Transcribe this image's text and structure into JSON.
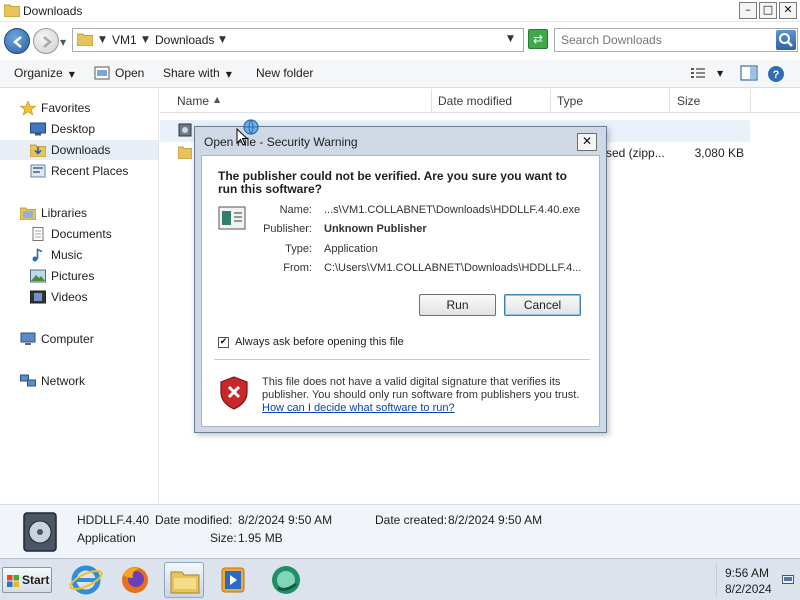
{
  "window": {
    "title": "Downloads"
  },
  "window_controls": {
    "minimize": "–",
    "maximize": "□",
    "close": "✕"
  },
  "address": {
    "crumbs": [
      "VM1",
      "Downloads"
    ]
  },
  "search": {
    "placeholder": "Search Downloads"
  },
  "toolbar": {
    "organize": "Organize",
    "open": "Open",
    "share_with": "Share with",
    "new_folder": "New folder"
  },
  "sidebar": {
    "favorites": [
      {
        "label": "Favorites",
        "icon": "star-icon"
      },
      {
        "label": "Desktop",
        "icon": "desktop-icon"
      },
      {
        "label": "Downloads",
        "icon": "downloads-folder-icon",
        "selected": true
      },
      {
        "label": "Recent Places",
        "icon": "recent-places-icon"
      }
    ],
    "libraries": [
      {
        "label": "Libraries",
        "icon": "libraries-icon"
      },
      {
        "label": "Documents",
        "icon": "documents-icon"
      },
      {
        "label": "Music",
        "icon": "music-icon"
      },
      {
        "label": "Pictures",
        "icon": "pictures-icon"
      },
      {
        "label": "Videos",
        "icon": "videos-icon"
      }
    ],
    "computer": {
      "label": "Computer",
      "icon": "computer-icon"
    },
    "network": {
      "label": "Network",
      "icon": "network-icon"
    }
  },
  "columns": {
    "name": "Name",
    "date_modified": "Date modified",
    "type": "Type",
    "size": "Size"
  },
  "files": [
    {
      "type": "sed (zipp...",
      "size": "3,080 KB"
    }
  ],
  "details": {
    "name": "HDDLLF.4.40",
    "type": "Application",
    "date_modified_label": "Date modified:",
    "date_modified": "8/2/2024 9:50 AM",
    "date_created_label": "Date created:",
    "date_created": "8/2/2024 9:50 AM",
    "size_label": "Size:",
    "size": "1.95 MB"
  },
  "taskbar": {
    "start": "Start",
    "time": "9:56 AM",
    "date": "8/2/2024",
    "apps": [
      "internet-explorer-icon",
      "firefox-icon",
      "file-explorer-icon",
      "media-player-icon",
      "media-app-icon"
    ]
  },
  "dialog": {
    "title": "Open File - Security Warning",
    "close": "✕",
    "heading": "The publisher could not be verified.  Are you sure you want to run this software?",
    "name_label": "Name:",
    "name": "...s\\VM1.COLLABNET\\Downloads\\HDDLLF.4.40.exe",
    "publisher_label": "Publisher:",
    "publisher": "Unknown Publisher",
    "type_label": "Type:",
    "type": "Application",
    "from_label": "From:",
    "from": "C:\\Users\\VM1.COLLABNET\\Downloads\\HDDLLF.4...",
    "run_button": "Run",
    "cancel_button": "Cancel",
    "checkbox_label": "Always ask before opening this file",
    "checkbox_checked": true,
    "checkbox_mark": "✔",
    "warning_text": "This file does not have a valid digital signature that verifies its publisher.  You should only run software from publishers you trust.",
    "warning_link": "How can I decide what software to run?"
  },
  "colors": {
    "selection": "#e8eef6",
    "link": "#0645ad",
    "dialog_frame": "#cfd9e6",
    "shield_red": "#c8282a"
  }
}
